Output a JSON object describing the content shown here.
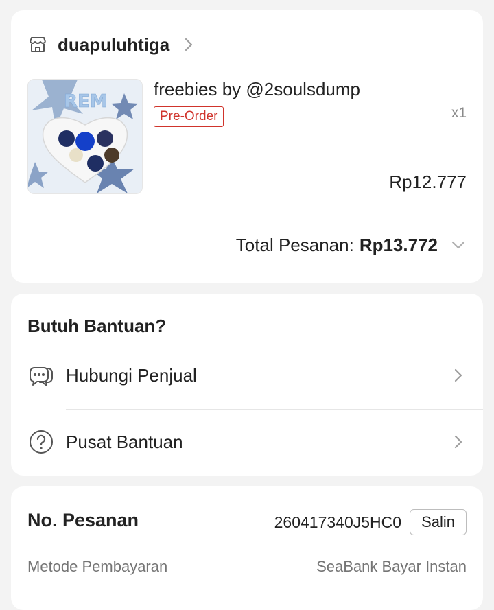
{
  "order": {
    "shop_name": "duapuluhtiga",
    "product": {
      "title": "freebies by @2soulsdump",
      "badge": "Pre-Order",
      "quantity": "x1",
      "price": "Rp12.777",
      "thumbnail_text": "REM"
    },
    "total_label": "Total Pesanan:",
    "total_value": "Rp13.772"
  },
  "help": {
    "title": "Butuh Bantuan?",
    "items": [
      {
        "label": "Hubungi Penjual",
        "icon": "chat-icon"
      },
      {
        "label": "Pusat Bantuan",
        "icon": "question-circle-icon"
      }
    ]
  },
  "info": {
    "order_number_label": "No. Pesanan",
    "order_number": "260417340J5HC0",
    "copy_label": "Salin",
    "payment_label": "Metode Pembayaran",
    "payment_value": "SeaBank Bayar Instan"
  },
  "colors": {
    "background": "#f3f3f3",
    "card": "#ffffff",
    "badge": "#d0342c",
    "muted_text": "#757575",
    "icon_gray": "#8a8a8a"
  }
}
